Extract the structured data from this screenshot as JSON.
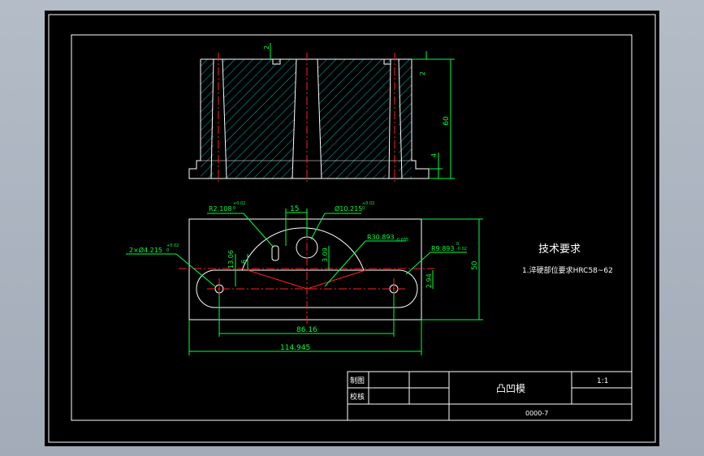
{
  "drawing": {
    "tech_title": "技术要求",
    "tech_note": "1.淬硬部位要求HRC58~62",
    "dims": {
      "side_top": "2",
      "side_right_top": "2",
      "height": "60",
      "foot": "4",
      "r_small": "R2.108",
      "r_small_tol": "+0.02\n0",
      "width_15": "15",
      "dia_hole": "Ø10.215",
      "dia_hole_tol": "+0.02\n0",
      "holes_2x": "2×Ø4.215",
      "holes_tol": "+0.02\n0",
      "r_arc": "R30.893",
      "r_arc_tol": "-0.035",
      "r_slot": "R9.893",
      "r_slot_tol": "0\n-0.02",
      "v_13_06": "13.06",
      "v_6": "6",
      "v_3_09": "3.09",
      "v_2_94": "2.94",
      "span_86": "86.16",
      "span_114": "114.945",
      "depth_50": "50"
    }
  },
  "title_block": {
    "drawn_label": "制图",
    "checked_label": "校核",
    "part_name": "凸凹模",
    "scale": "1:1",
    "drawing_no": "0000-7"
  },
  "colors": {
    "border": "#ffffff",
    "outline": "#ffffff",
    "hatch": "#00c8c8",
    "centerline": "#ff2020",
    "dimension": "#00ff40",
    "text": "#ffffff"
  }
}
